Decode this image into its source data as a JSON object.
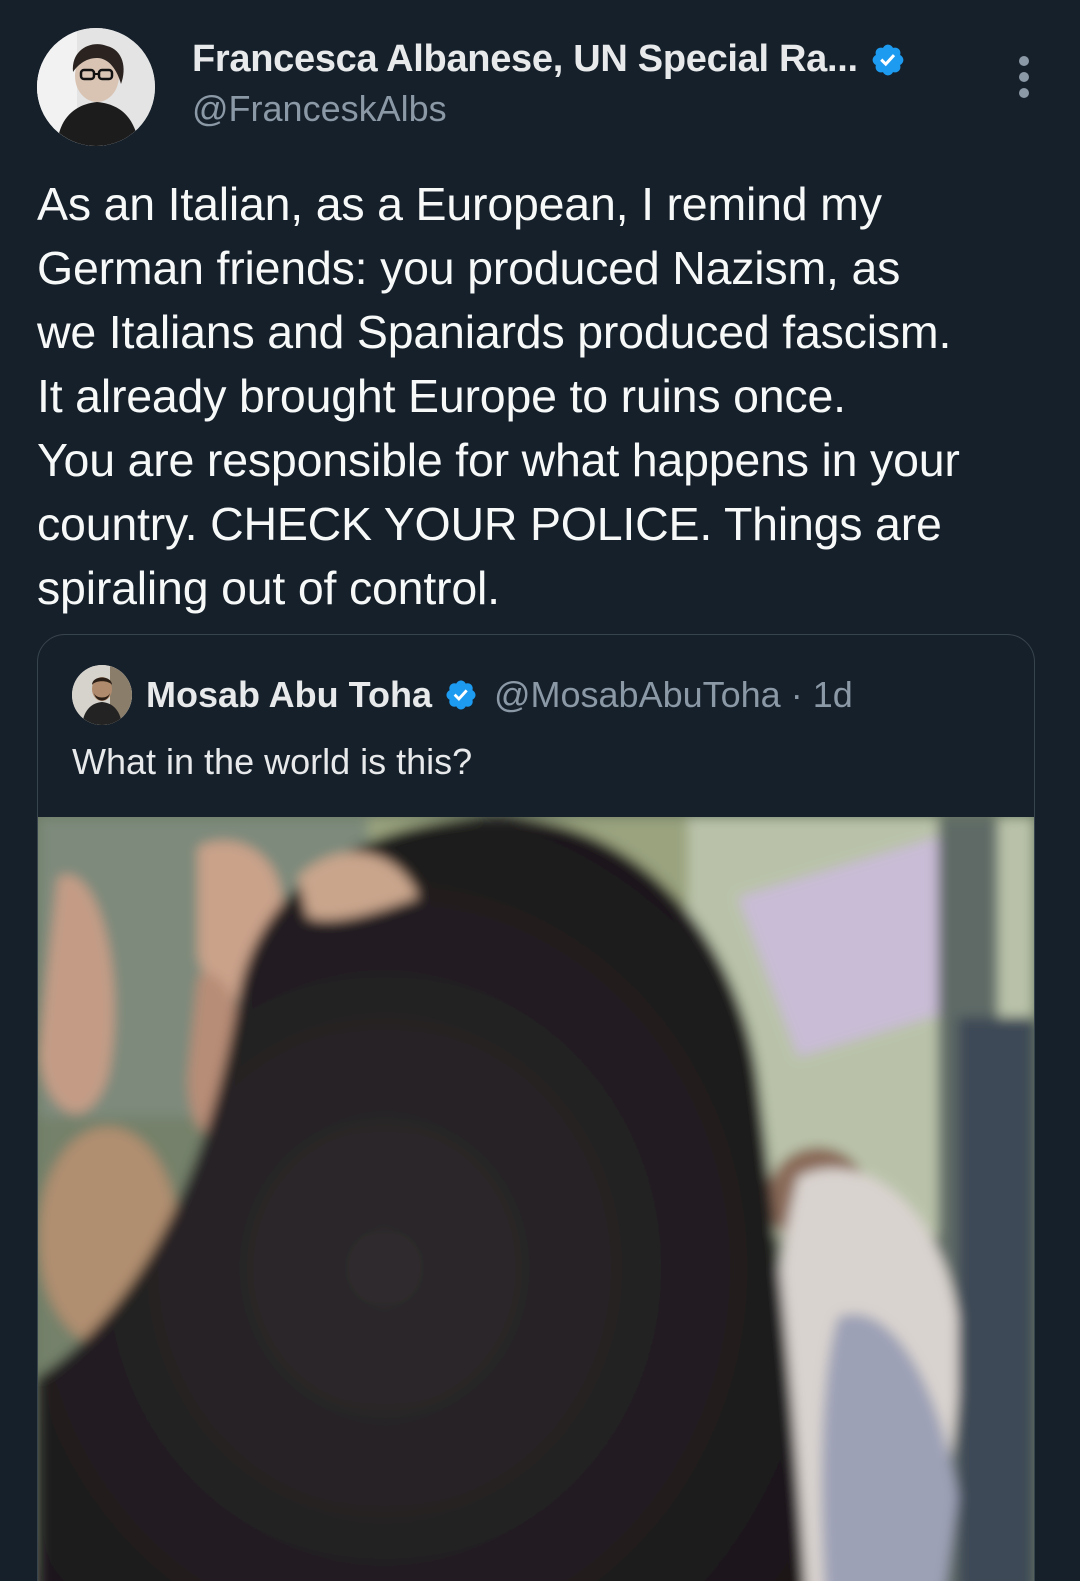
{
  "tweet": {
    "author": {
      "display_name": "Francesca Albanese, UN Special Ra...",
      "handle": "@FranceskAlbs",
      "verified": true
    },
    "text": "As an Italian, as a European, I remind my\nGerman friends: you produced Nazism, as\nwe Italians and Spaniards produced fascism.\nIt already brought Europe to ruins once.\nYou are responsible for what happens in your\ncountry. CHECK YOUR POLICE. Things are\nspiraling out of control.",
    "more_icon": "more-vertical-icon"
  },
  "quoted_tweet": {
    "author": {
      "display_name": "Mosab Abu Toha",
      "handle": "@MosabAbuToha",
      "verified": true
    },
    "time": "· 1d",
    "text": "What in the world is this?",
    "media": "video-still"
  },
  "colors": {
    "background": "#15202b",
    "text": "#e7e9ea",
    "secondary_text": "#8b98a5",
    "verified_badge": "#1d9bf0",
    "border": "#38444d"
  }
}
